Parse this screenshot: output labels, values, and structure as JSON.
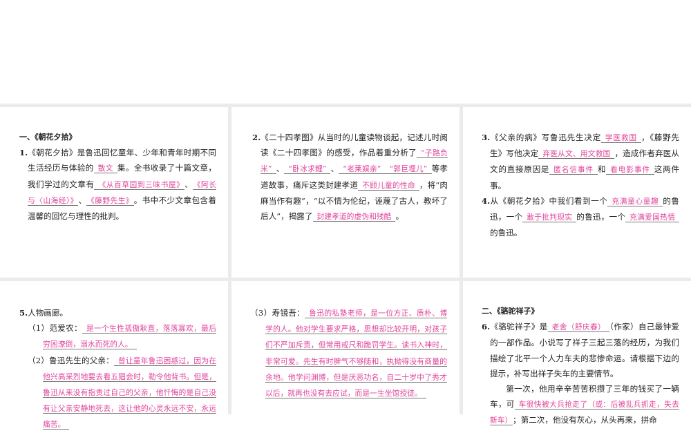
{
  "section1_title": "一、《朝花夕拾》",
  "section2_title": "二、《骆驼祥子》",
  "q1": [
    {
      "t": "1.",
      "n": 1
    },
    {
      "t": "《朝花夕拾》是鲁迅回忆童年、少年和青年时期不同生活经历与体验的"
    },
    {
      "a": "散文"
    },
    {
      "t": "集。全书收录了十篇文章，我们学过的文章有"
    },
    {
      "a": "《从百草园到三味书屋》"
    },
    {
      "t": "、"
    },
    {
      "a": "《阿长与〈山海经〉》"
    },
    {
      "t": "、"
    },
    {
      "a": "《藤野先生》"
    },
    {
      "t": "。书中不少文章包含着温馨的回忆与理性的批判。"
    }
  ],
  "q2": [
    {
      "t": "2.",
      "n": 1
    },
    {
      "t": "《二十四孝图》从当时的儿童读物谈起，记述儿时阅读《二十四孝图》的感受，作品着重分析了"
    },
    {
      "a": "“子路负米”"
    },
    {
      "t": "、"
    },
    {
      "a": "“卧冰求鲤”"
    },
    {
      "t": "、"
    },
    {
      "a": "“老莱娱亲”"
    },
    {
      "a": "“郭巨埋儿”"
    },
    {
      "t": "等孝道故事，痛斥这类封建孝道"
    },
    {
      "a": "不顾儿童的性命"
    },
    {
      "t": "，将“肉麻当作有趣”，“以不情为伦纪，诬蔑了古人，教坏了后人”，揭露了"
    },
    {
      "a": "封建孝道的虚伪和残酷"
    },
    {
      "t": "。"
    }
  ],
  "q3": [
    {
      "t": "3.",
      "n": 1
    },
    {
      "t": "《父亲的病》写鲁迅先生决定"
    },
    {
      "a": "学医救国"
    },
    {
      "t": "，《藤野先生》写他决定"
    },
    {
      "a": "弃医从文、用文救国"
    },
    {
      "t": "，造成作者弃医从文的直接原因是"
    },
    {
      "a": "匿名信事件"
    },
    {
      "t": "和"
    },
    {
      "a": "看电影事件"
    },
    {
      "t": "这两件事。"
    }
  ],
  "q4": [
    {
      "t": "4.",
      "n": 1
    },
    {
      "t": "从《朝花夕拾》中我们看到一个"
    },
    {
      "a": "充满童心童趣"
    },
    {
      "t": "的鲁迅，一个"
    },
    {
      "a": "敢于批判现实"
    },
    {
      "t": "的鲁迅，一个"
    },
    {
      "a": "充满爱国热情"
    },
    {
      "t": "的鲁迅。"
    }
  ],
  "q5": [
    {
      "t": "5.",
      "n": 1
    },
    {
      "t": "人物画廊。"
    }
  ],
  "q5_1": [
    {
      "t": "（1）范爱农："
    },
    {
      "a": "是一个生性孤傲耿直，落落寡欢，最后穷困潦倒，溺水而死的人。"
    }
  ],
  "q5_2": [
    {
      "t": "（2）鲁迅先生的父亲："
    },
    {
      "a": "曾让童年鲁迅困惑过，因为在他兴高采烈地要去看五猖会时，勒令他背书。但是，鲁迅从来没有指责过自己的父亲，他忏悔的是自己没有让父亲安静地死去，这让他的心灵永远不安，永远痛苦。"
    }
  ],
  "q5_3": [
    {
      "t": "（3）寿镜吾："
    },
    {
      "a": "鲁迅的私塾老师，是一位方正、质朴、博学的人。他对学生要求严格，思想却比较开明，对孩子们不严加斥责，但常用戒尺和跪罚学生。读书入神时，非常可爱。先生有时脾气不够随和，执拗得没有商量的余地。他学问渊博，但是厌恶功名，自二十岁中了秀才以后，就再也没有去应试，而是一生坐馆授徒。"
    }
  ],
  "q6": [
    {
      "t": "6.",
      "n": 1
    },
    {
      "t": "《骆驼祥子》是"
    },
    {
      "a": "老舍（舒庆春）"
    },
    {
      "t": "（作家）自己最钟爱的一部作品。小说写了祥子三起三落的经历，为我们描绘了北平一个人力车夫的悲惨命运。请根据下边的提示，补写出祥子失车的主要情节。"
    }
  ],
  "q6_p": [
    {
      "t": "第一次，他用辛辛苦苦积攒了三年的钱买了一辆车，可"
    },
    {
      "a": "车很快被大兵抢走了（或：后被乱兵抓走，失去新车）"
    },
    {
      "t": "；第二次，他没有灰心，从头再来，拼命"
    }
  ],
  "colors": {
    "answer": "#e0459a",
    "gutter": "#ebebeb"
  }
}
